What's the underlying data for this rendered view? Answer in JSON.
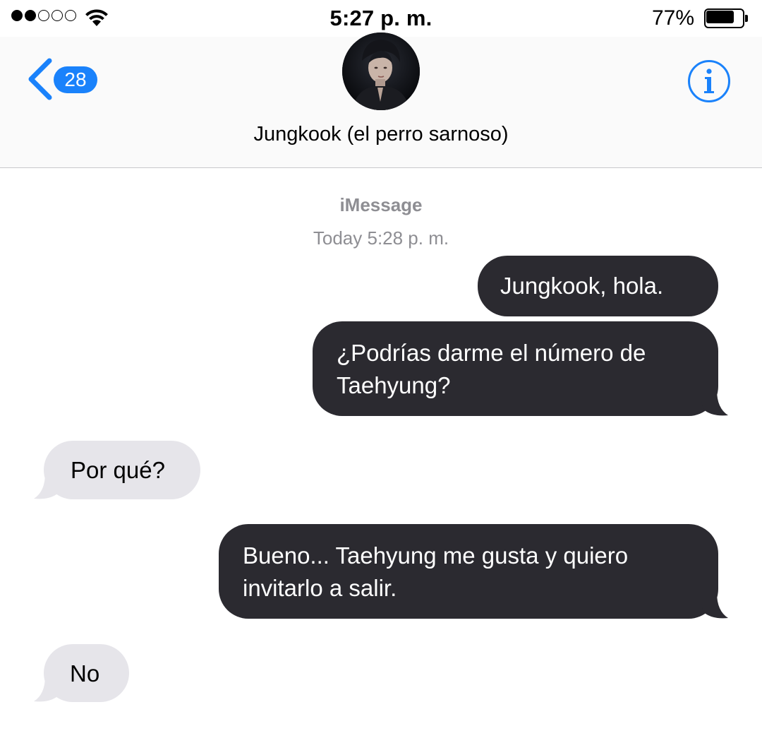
{
  "status_bar": {
    "signal_bars_filled": 2,
    "signal_bars_total": 5,
    "wifi_icon": "wifi-icon",
    "time": "5:27 p. m.",
    "battery_percent": "77%",
    "battery_level": 0.77
  },
  "header": {
    "back_icon": "chevron-left-icon",
    "unread_count": "28",
    "contact_name": "Jungkook (el perro sarnoso)",
    "info_icon": "info-icon"
  },
  "thread": {
    "service_label": "iMessage",
    "timestamp": "Today 5:28 p. m.",
    "messages": [
      {
        "direction": "sent",
        "lines": [
          "Jungkook, hola."
        ]
      },
      {
        "direction": "sent",
        "lines": [
          "¿Podrías darme el número de",
          "Taehyung?"
        ]
      },
      {
        "direction": "received",
        "lines": [
          "Por qué?"
        ]
      },
      {
        "direction": "sent",
        "lines": [
          "Bueno... Taehyung me gusta y quiero",
          "invitarlo a salir."
        ]
      },
      {
        "direction": "received",
        "lines": [
          "No"
        ]
      }
    ]
  },
  "colors": {
    "accent_blue": "#1a82fb",
    "sent_bubble": "#2b2a30",
    "received_bubble": "#e6e5ea",
    "meta_text": "#8e8e93"
  }
}
